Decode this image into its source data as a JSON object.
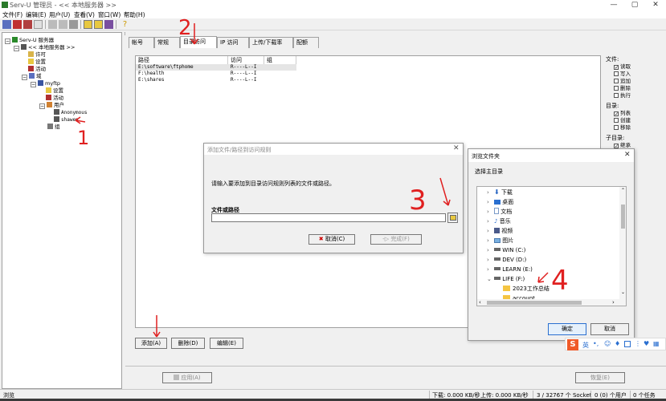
{
  "window": {
    "title": "Serv-U 管理员 - << 本地服务器 >>",
    "minimize": "—",
    "maximize": "▢",
    "close": "✕"
  },
  "menu": [
    "文件(F)",
    "编辑(E)",
    "用户(U)",
    "查看(V)",
    "窗口(W)",
    "帮助(H)"
  ],
  "tree": {
    "root": "Serv-U 服务器",
    "server": "<< 本地服务器 >>",
    "license": "许可",
    "settings": "设置",
    "activity": "活动",
    "domain": "域",
    "domain_name": "myftp",
    "domain_settings": "设置",
    "domain_activity": "活动",
    "users": "用户",
    "user1": "Anonymous",
    "user2": "shawen",
    "groups": "组"
  },
  "tabs": [
    "帐号",
    "常规",
    "目录访问",
    "IP 访问",
    "上传/下载率",
    "配额"
  ],
  "listview": {
    "headers": [
      "路径",
      "访问",
      "组"
    ],
    "rows": [
      {
        "path": "E:\\software\\ftphome",
        "access": "R----L--I"
      },
      {
        "path": "F:\\health",
        "access": "R----L--I"
      },
      {
        "path": "E:\\shares",
        "access": "R----L--I"
      }
    ]
  },
  "rightpanel": {
    "files_label": "文件:",
    "files": [
      {
        "label": "读取",
        "checked": true
      },
      {
        "label": "写入",
        "checked": false
      },
      {
        "label": "追加",
        "checked": false
      },
      {
        "label": "删除",
        "checked": false
      },
      {
        "label": "执行",
        "checked": false
      }
    ],
    "dirs_label": "目录:",
    "dirs": [
      {
        "label": "列表",
        "checked": true
      },
      {
        "label": "创建",
        "checked": false
      },
      {
        "label": "移除",
        "checked": false
      }
    ],
    "subdirs_label": "子目录:",
    "subdirs": [
      {
        "label": "继承",
        "checked": true
      }
    ]
  },
  "buttons": {
    "add": "添加(A)",
    "delete": "删除(D)",
    "edit": "编辑(E)",
    "apply": "应用(A)",
    "restore": "恢复(E)"
  },
  "add_dialog": {
    "title": "添加文件/路径到访问规则",
    "prompt": "请输入要添加到目录访问规则列表的文件或路径。",
    "field_label": "文件或路径",
    "field_value": "",
    "cancel": "取消(C)",
    "finish": "完成(F)"
  },
  "browse_dialog": {
    "title": "浏览文件夹",
    "subtitle": "选择主目录",
    "items": [
      {
        "label": "下载",
        "indent": 1,
        "chev": ">"
      },
      {
        "label": "桌面",
        "indent": 1,
        "chev": ">"
      },
      {
        "label": "文档",
        "indent": 1,
        "chev": ">"
      },
      {
        "label": "音乐",
        "indent": 1,
        "chev": ">"
      },
      {
        "label": "视频",
        "indent": 1,
        "chev": ">"
      },
      {
        "label": "图片",
        "indent": 1,
        "chev": ">"
      },
      {
        "label": "WIN (C:)",
        "indent": 1,
        "chev": ">"
      },
      {
        "label": "DEV (D:)",
        "indent": 1,
        "chev": ">"
      },
      {
        "label": "LEARN (E:)",
        "indent": 1,
        "chev": ">"
      },
      {
        "label": "LIFE (F:)",
        "indent": 1,
        "chev": "v"
      },
      {
        "label": "2023工作总结",
        "indent": 2,
        "chev": ""
      },
      {
        "label": "account",
        "indent": 2,
        "chev": ""
      }
    ],
    "ok": "确定",
    "cancel": "取消"
  },
  "statusbar": {
    "left": "浏览",
    "down": "下载: 0.000 KB/秒",
    "up": "上传: 0.000 KB/秒",
    "socket": "3 / 32767 个 Socket",
    "users_count": "0 (0) 个用户",
    "tasks": "0 个任务"
  },
  "annotations": [
    "1",
    "2",
    "3",
    "4"
  ],
  "ime": {
    "label": "英",
    "logo": "S"
  }
}
